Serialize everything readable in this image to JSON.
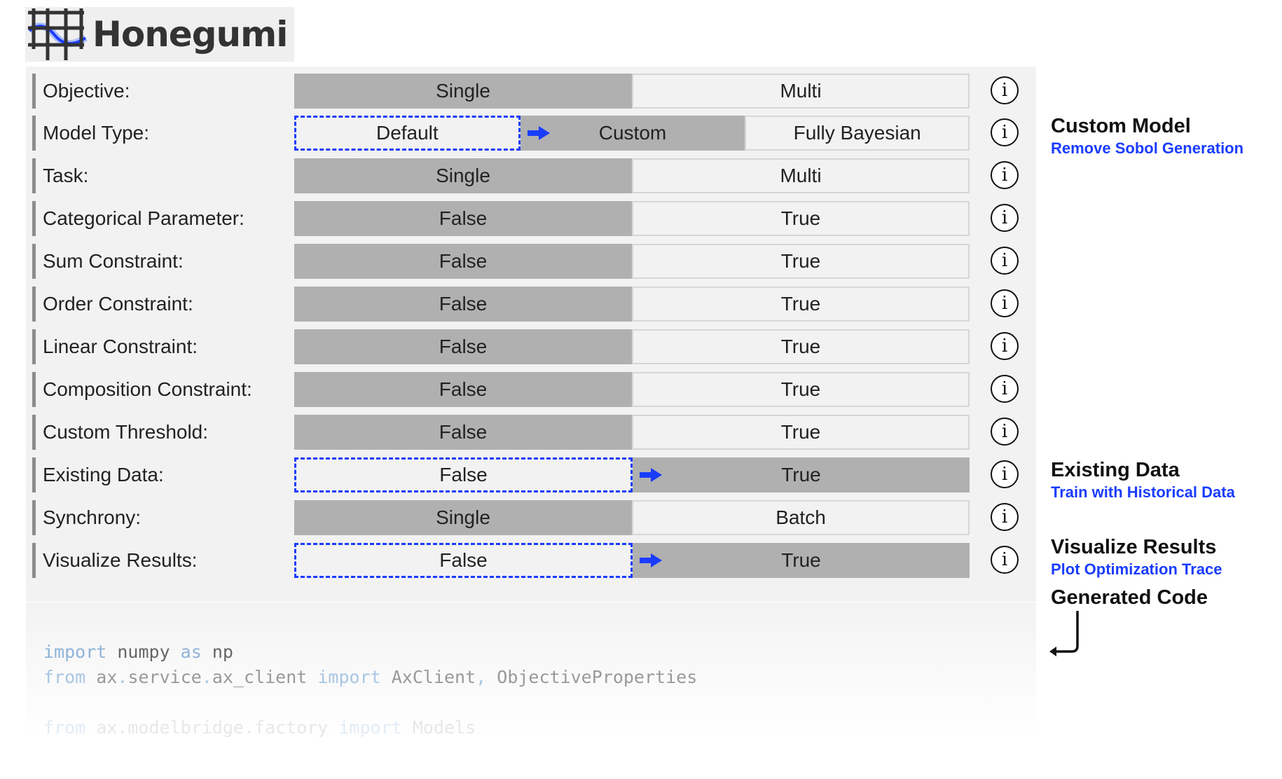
{
  "app": {
    "name": "Honegumi"
  },
  "rows": [
    {
      "label": "Objective:",
      "options": [
        "Single",
        "Multi"
      ]
    },
    {
      "label": "Model Type:",
      "options": [
        "Default",
        "Custom",
        "Fully Bayesian"
      ]
    },
    {
      "label": "Task:",
      "options": [
        "Single",
        "Multi"
      ]
    },
    {
      "label": "Categorical Parameter:",
      "options": [
        "False",
        "True"
      ]
    },
    {
      "label": "Sum Constraint:",
      "options": [
        "False",
        "True"
      ]
    },
    {
      "label": "Order Constraint:",
      "options": [
        "False",
        "True"
      ]
    },
    {
      "label": "Linear Constraint:",
      "options": [
        "False",
        "True"
      ]
    },
    {
      "label": "Composition Constraint:",
      "options": [
        "False",
        "True"
      ]
    },
    {
      "label": "Custom Threshold:",
      "options": [
        "False",
        "True"
      ]
    },
    {
      "label": "Existing Data:",
      "options": [
        "False",
        "True"
      ]
    },
    {
      "label": "Synchrony:",
      "options": [
        "Single",
        "Batch"
      ]
    },
    {
      "label": "Visualize Results:",
      "options": [
        "False",
        "True"
      ]
    }
  ],
  "info_symbol": "i",
  "annotations": {
    "custom_model": {
      "title": "Custom Model",
      "subtitle": "Remove Sobol Generation"
    },
    "existing_data": {
      "title": "Existing Data",
      "subtitle": "Train with Historical Data"
    },
    "visualize_results": {
      "title": "Visualize Results",
      "subtitle": "Plot Optimization Trace"
    },
    "generated_code": {
      "title": "Generated Code"
    }
  },
  "code": {
    "line1": {
      "kw1": "import",
      "t1": " numpy ",
      "kw2": "as",
      "t2": " np"
    },
    "line2": {
      "kw1": "from",
      "t1": " ax",
      "d1": ".",
      "t2": "service",
      "d2": ".",
      "t3": "ax_client ",
      "kw2": "import",
      "t4": " AxClient",
      "d3": ",",
      "t5": " ObjectiveProperties"
    },
    "line3": {
      "kw1": "from",
      "t1": " ax.modelbridge.factory ",
      "kw2": "import",
      "t2": " Models"
    }
  },
  "colors": {
    "accent": "#1a3cff",
    "selected": "#b0b0b0",
    "panel": "#f2f2f2"
  },
  "icons": {
    "logo": "honegumi-logo-icon",
    "info": "info-icon",
    "arrow": "arrow-right-icon",
    "return": "return-arrow-icon"
  }
}
